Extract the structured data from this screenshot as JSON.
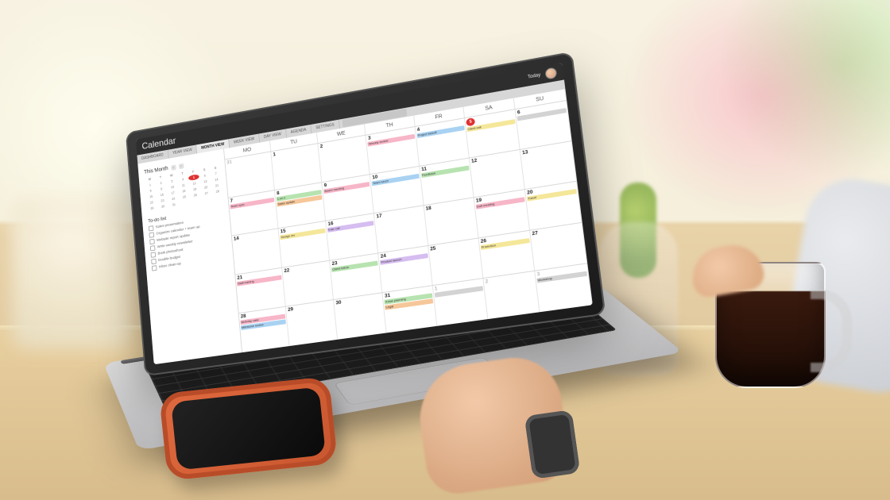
{
  "app": {
    "title": "Calendar",
    "today_label": "Today",
    "tabs": [
      "DASHBOARD",
      "YEAR VIEW",
      "MONTH VIEW",
      "WEEK VIEW",
      "DAY VIEW",
      "AGENDA",
      "SETTINGS"
    ],
    "active_tab_index": 2
  },
  "sidebar": {
    "section_title": "This Month",
    "mini_dow": [
      "M",
      "T",
      "W",
      "T",
      "F",
      "S",
      "S"
    ],
    "mini_days": [
      1,
      2,
      3,
      4,
      5,
      6,
      7,
      8,
      9,
      10,
      11,
      12,
      13,
      14,
      15,
      16,
      17,
      18,
      19,
      20,
      21,
      22,
      23,
      24,
      25,
      26,
      27,
      28,
      29,
      30,
      31
    ],
    "today_day": 5,
    "todo_title": "To-do list",
    "todo": [
      "Sales presentation",
      "Organize calendar + team up",
      "Website report update",
      "Write weekly newsletter",
      "Book photoshoot",
      "Double budget",
      "Inbox clean-up"
    ]
  },
  "calendar": {
    "dow": [
      "MO",
      "TU",
      "WE",
      "TH",
      "FR",
      "SA",
      "SU"
    ],
    "weeks": [
      [
        {
          "n": 31,
          "off": true,
          "ev": []
        },
        {
          "n": 1,
          "ev": []
        },
        {
          "n": 2,
          "ev": []
        },
        {
          "n": 3,
          "ev": [
            {
              "t": "Weekly review",
              "c": "pk"
            }
          ]
        },
        {
          "n": 4,
          "ev": [
            {
              "t": "Project kickoff",
              "c": "bl"
            }
          ]
        },
        {
          "n": 5,
          "today": true,
          "ev": [
            {
              "t": "Client call",
              "c": "yl"
            }
          ]
        },
        {
          "n": 6,
          "ev": [
            {
              "t": "",
              "c": "gr"
            }
          ]
        }
      ],
      [
        {
          "n": 7,
          "ev": [
            {
              "t": "Team sync",
              "c": "pk"
            }
          ]
        },
        {
          "n": 8,
          "ev": [
            {
              "t": "1:on:1",
              "c": "gn"
            },
            {
              "t": "Sales update",
              "c": "or"
            }
          ]
        },
        {
          "n": 9,
          "ev": [
            {
              "t": "Board meeting",
              "c": "pk"
            }
          ]
        },
        {
          "n": 10,
          "ev": [
            {
              "t": "Team lunch",
              "c": "bl"
            }
          ]
        },
        {
          "n": 11,
          "ev": [
            {
              "t": "Feedback",
              "c": "gn"
            }
          ]
        },
        {
          "n": 12,
          "ev": []
        },
        {
          "n": 13,
          "ev": []
        }
      ],
      [
        {
          "n": 14,
          "ev": []
        },
        {
          "n": 15,
          "ev": [
            {
              "t": "Design rev",
              "c": "yl"
            }
          ]
        },
        {
          "n": 16,
          "ev": [
            {
              "t": "Inter call",
              "c": "pu"
            }
          ]
        },
        {
          "n": 17,
          "ev": []
        },
        {
          "n": 18,
          "ev": []
        },
        {
          "n": 19,
          "ev": [
            {
              "t": "Golf meeting",
              "c": "pk"
            }
          ]
        },
        {
          "n": 20,
          "ev": [
            {
              "t": "Travel",
              "c": "yl"
            }
          ]
        }
      ],
      [
        {
          "n": 21,
          "ev": [
            {
              "t": "Staff training",
              "c": "pk"
            }
          ]
        },
        {
          "n": 22,
          "ev": []
        },
        {
          "n": 23,
          "ev": [
            {
              "t": "Client follow",
              "c": "gn"
            }
          ]
        },
        {
          "n": 24,
          "ev": [
            {
              "t": "Product launch",
              "c": "pu"
            }
          ]
        },
        {
          "n": 25,
          "ev": []
        },
        {
          "n": 26,
          "ev": [
            {
              "t": "Promotion",
              "c": "yl"
            }
          ]
        },
        {
          "n": 27,
          "ev": []
        }
      ],
      [
        {
          "n": 28,
          "ev": [
            {
              "t": "Birthday cake",
              "c": "pk"
            },
            {
              "t": "Milestone review",
              "c": "bl"
            }
          ]
        },
        {
          "n": 29,
          "ev": []
        },
        {
          "n": 30,
          "ev": []
        },
        {
          "n": 31,
          "ev": [
            {
              "t": "Xmas planning",
              "c": "gn"
            },
            {
              "t": "Legal",
              "c": "or"
            }
          ]
        },
        {
          "n": 1,
          "off": true,
          "ev": [
            {
              "t": "",
              "c": "gr"
            }
          ]
        },
        {
          "n": 2,
          "off": true,
          "ev": []
        },
        {
          "n": 3,
          "off": true,
          "ev": [
            {
              "t": "Workshop",
              "c": "gr"
            }
          ]
        }
      ]
    ]
  }
}
